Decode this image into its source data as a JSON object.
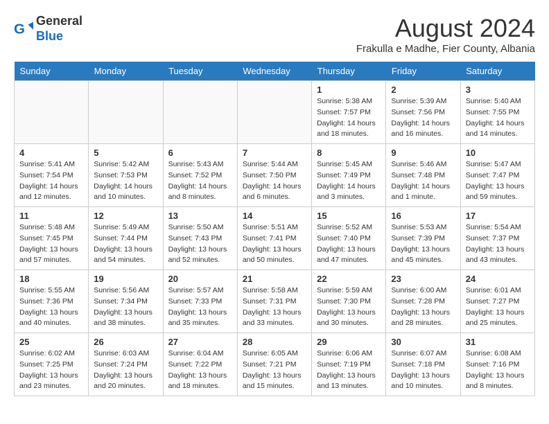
{
  "header": {
    "logo_general": "General",
    "logo_blue": "Blue",
    "month_year": "August 2024",
    "location": "Frakulla e Madhe, Fier County, Albania"
  },
  "days_of_week": [
    "Sunday",
    "Monday",
    "Tuesday",
    "Wednesday",
    "Thursday",
    "Friday",
    "Saturday"
  ],
  "weeks": [
    [
      {
        "num": "",
        "info": ""
      },
      {
        "num": "",
        "info": ""
      },
      {
        "num": "",
        "info": ""
      },
      {
        "num": "",
        "info": ""
      },
      {
        "num": "1",
        "info": "Sunrise: 5:38 AM\nSunset: 7:57 PM\nDaylight: 14 hours\nand 18 minutes."
      },
      {
        "num": "2",
        "info": "Sunrise: 5:39 AM\nSunset: 7:56 PM\nDaylight: 14 hours\nand 16 minutes."
      },
      {
        "num": "3",
        "info": "Sunrise: 5:40 AM\nSunset: 7:55 PM\nDaylight: 14 hours\nand 14 minutes."
      }
    ],
    [
      {
        "num": "4",
        "info": "Sunrise: 5:41 AM\nSunset: 7:54 PM\nDaylight: 14 hours\nand 12 minutes."
      },
      {
        "num": "5",
        "info": "Sunrise: 5:42 AM\nSunset: 7:53 PM\nDaylight: 14 hours\nand 10 minutes."
      },
      {
        "num": "6",
        "info": "Sunrise: 5:43 AM\nSunset: 7:52 PM\nDaylight: 14 hours\nand 8 minutes."
      },
      {
        "num": "7",
        "info": "Sunrise: 5:44 AM\nSunset: 7:50 PM\nDaylight: 14 hours\nand 6 minutes."
      },
      {
        "num": "8",
        "info": "Sunrise: 5:45 AM\nSunset: 7:49 PM\nDaylight: 14 hours\nand 3 minutes."
      },
      {
        "num": "9",
        "info": "Sunrise: 5:46 AM\nSunset: 7:48 PM\nDaylight: 14 hours\nand 1 minute."
      },
      {
        "num": "10",
        "info": "Sunrise: 5:47 AM\nSunset: 7:47 PM\nDaylight: 13 hours\nand 59 minutes."
      }
    ],
    [
      {
        "num": "11",
        "info": "Sunrise: 5:48 AM\nSunset: 7:45 PM\nDaylight: 13 hours\nand 57 minutes."
      },
      {
        "num": "12",
        "info": "Sunrise: 5:49 AM\nSunset: 7:44 PM\nDaylight: 13 hours\nand 54 minutes."
      },
      {
        "num": "13",
        "info": "Sunrise: 5:50 AM\nSunset: 7:43 PM\nDaylight: 13 hours\nand 52 minutes."
      },
      {
        "num": "14",
        "info": "Sunrise: 5:51 AM\nSunset: 7:41 PM\nDaylight: 13 hours\nand 50 minutes."
      },
      {
        "num": "15",
        "info": "Sunrise: 5:52 AM\nSunset: 7:40 PM\nDaylight: 13 hours\nand 47 minutes."
      },
      {
        "num": "16",
        "info": "Sunrise: 5:53 AM\nSunset: 7:39 PM\nDaylight: 13 hours\nand 45 minutes."
      },
      {
        "num": "17",
        "info": "Sunrise: 5:54 AM\nSunset: 7:37 PM\nDaylight: 13 hours\nand 43 minutes."
      }
    ],
    [
      {
        "num": "18",
        "info": "Sunrise: 5:55 AM\nSunset: 7:36 PM\nDaylight: 13 hours\nand 40 minutes."
      },
      {
        "num": "19",
        "info": "Sunrise: 5:56 AM\nSunset: 7:34 PM\nDaylight: 13 hours\nand 38 minutes."
      },
      {
        "num": "20",
        "info": "Sunrise: 5:57 AM\nSunset: 7:33 PM\nDaylight: 13 hours\nand 35 minutes."
      },
      {
        "num": "21",
        "info": "Sunrise: 5:58 AM\nSunset: 7:31 PM\nDaylight: 13 hours\nand 33 minutes."
      },
      {
        "num": "22",
        "info": "Sunrise: 5:59 AM\nSunset: 7:30 PM\nDaylight: 13 hours\nand 30 minutes."
      },
      {
        "num": "23",
        "info": "Sunrise: 6:00 AM\nSunset: 7:28 PM\nDaylight: 13 hours\nand 28 minutes."
      },
      {
        "num": "24",
        "info": "Sunrise: 6:01 AM\nSunset: 7:27 PM\nDaylight: 13 hours\nand 25 minutes."
      }
    ],
    [
      {
        "num": "25",
        "info": "Sunrise: 6:02 AM\nSunset: 7:25 PM\nDaylight: 13 hours\nand 23 minutes."
      },
      {
        "num": "26",
        "info": "Sunrise: 6:03 AM\nSunset: 7:24 PM\nDaylight: 13 hours\nand 20 minutes."
      },
      {
        "num": "27",
        "info": "Sunrise: 6:04 AM\nSunset: 7:22 PM\nDaylight: 13 hours\nand 18 minutes."
      },
      {
        "num": "28",
        "info": "Sunrise: 6:05 AM\nSunset: 7:21 PM\nDaylight: 13 hours\nand 15 minutes."
      },
      {
        "num": "29",
        "info": "Sunrise: 6:06 AM\nSunset: 7:19 PM\nDaylight: 13 hours\nand 13 minutes."
      },
      {
        "num": "30",
        "info": "Sunrise: 6:07 AM\nSunset: 7:18 PM\nDaylight: 13 hours\nand 10 minutes."
      },
      {
        "num": "31",
        "info": "Sunrise: 6:08 AM\nSunset: 7:16 PM\nDaylight: 13 hours\nand 8 minutes."
      }
    ]
  ]
}
